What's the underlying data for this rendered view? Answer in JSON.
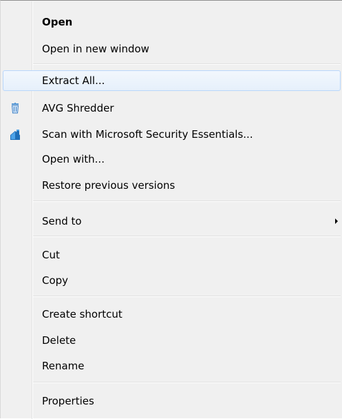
{
  "menu": {
    "open": "Open",
    "open_new_window": "Open in new window",
    "extract_all": "Extract All...",
    "avg_shredder": "AVG Shredder",
    "scan_mse": "Scan with Microsoft Security Essentials...",
    "open_with": "Open with...",
    "restore_previous": "Restore previous versions",
    "send_to": "Send to",
    "cut": "Cut",
    "copy": "Copy",
    "create_shortcut": "Create shortcut",
    "delete": "Delete",
    "rename": "Rename",
    "properties": "Properties"
  },
  "icons": {
    "avg_shredder": "shredder-icon",
    "scan_mse": "security-essentials-icon",
    "send_to": "submenu-arrow-icon"
  },
  "colors": {
    "menu_background": "#f0f0f0",
    "highlight_border": "#b8d6fb",
    "highlight_fill": "#e6f0fb"
  }
}
